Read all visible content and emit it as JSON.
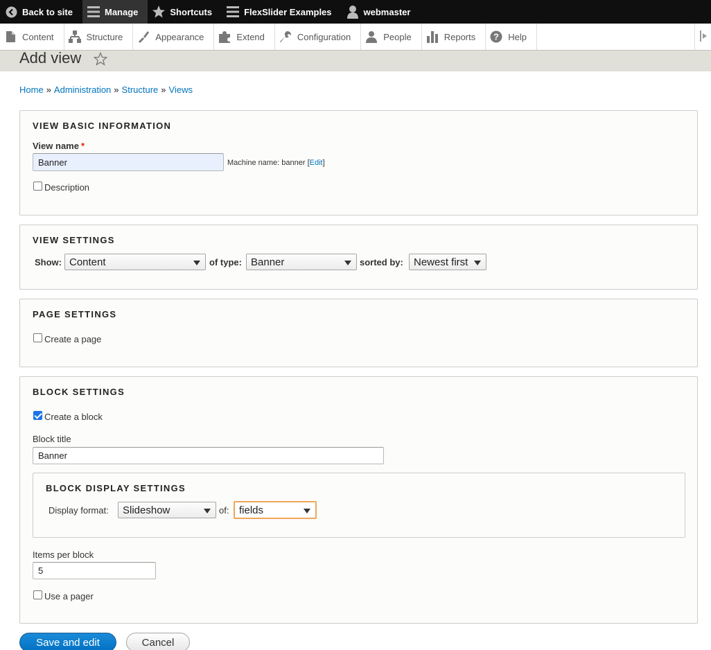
{
  "toolbar": {
    "back_to_site": "Back to site",
    "manage": "Manage",
    "shortcuts": "Shortcuts",
    "flexslider": "FlexSlider Examples",
    "user": "webmaster"
  },
  "tray": {
    "content": "Content",
    "structure": "Structure",
    "appearance": "Appearance",
    "extend": "Extend",
    "configuration": "Configuration",
    "people": "People",
    "reports": "Reports",
    "help": "Help"
  },
  "page": {
    "title": "Add view"
  },
  "breadcrumb": {
    "home": "Home",
    "administration": "Administration",
    "structure": "Structure",
    "views": "Views",
    "separator": "»"
  },
  "basic": {
    "legend": "VIEW BASIC INFORMATION",
    "view_name_label": "View name",
    "required_mark": "*",
    "view_name_value": "Banner",
    "machine_name_prefix": "Machine name: banner [",
    "machine_name_edit": "Edit",
    "machine_name_suffix": "]",
    "description_label": "Description"
  },
  "view_settings": {
    "legend": "VIEW SETTINGS",
    "show_label": "Show:",
    "show_value": "Content",
    "of_type_label": "of type:",
    "of_type_value": "Banner",
    "sorted_by_label": "sorted by:",
    "sorted_by_value": "Newest first"
  },
  "page_settings": {
    "legend": "PAGE SETTINGS",
    "create_page_label": "Create a page"
  },
  "block_settings": {
    "legend": "BLOCK SETTINGS",
    "create_block_label": "Create a block",
    "block_title_label": "Block title",
    "block_title_value": "Banner",
    "display": {
      "legend": "BLOCK DISPLAY SETTINGS",
      "format_label": "Display format:",
      "format_value": "Slideshow",
      "of_label": "of:",
      "of_value": "fields"
    },
    "items_per_block_label": "Items per block",
    "items_per_block_value": "5",
    "use_pager_label": "Use a pager"
  },
  "actions": {
    "save": "Save and edit",
    "cancel": "Cancel"
  },
  "colors": {
    "link": "#0074bd",
    "primary_button": "#0071c2",
    "focus_outline": "#f0a55a",
    "required": "#e32700"
  }
}
